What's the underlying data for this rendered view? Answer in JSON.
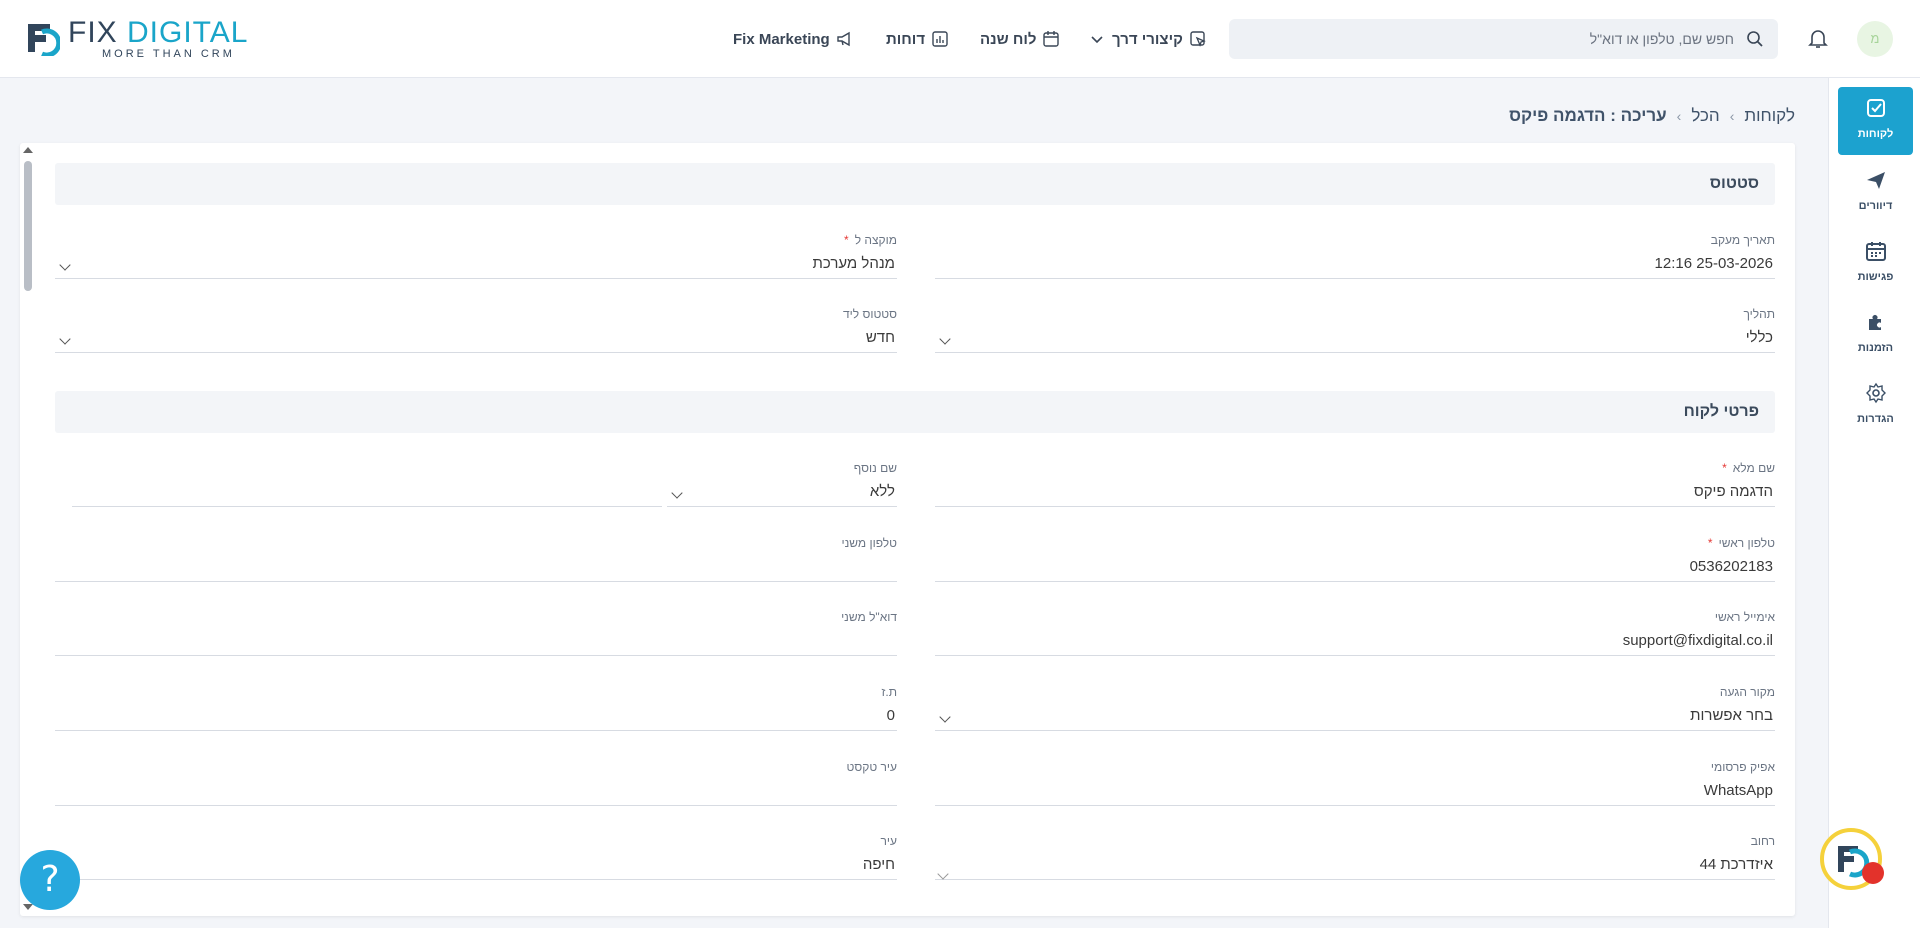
{
  "brand": {
    "name_a": "FIX ",
    "name_b": "DIGITAL",
    "tagline": "MORE THAN CRM",
    "accent": "#1ca2cf"
  },
  "header": {
    "search_placeholder": "חפש שם, טלפון או דוא\"ל",
    "nav": {
      "marketing": "Fix Marketing",
      "reports": "דוחות",
      "calendar": "לוח שנה",
      "shortcuts": "קיצורי דרך"
    },
    "avatar_initial": "מ"
  },
  "sidebar": {
    "items": [
      {
        "label": "לקוחות",
        "icon": "check-square-icon",
        "active": true
      },
      {
        "label": "דיוורים",
        "icon": "paper-plane-icon"
      },
      {
        "label": "פגישות",
        "icon": "calendar-icon"
      },
      {
        "label": "הזמנות",
        "icon": "puzzle-icon"
      },
      {
        "label": "הגדרות",
        "icon": "gear-icon"
      }
    ]
  },
  "breadcrumb": {
    "root": "לקוחות",
    "level2": "הכל",
    "current": "עריכה : הדגמה פיקס",
    "sep": "›"
  },
  "sections": {
    "status": "סטטוס",
    "customer": "פרטי לקוח"
  },
  "status_fields": {
    "followup_date": {
      "label": "תאריך מעקב",
      "value": "25-03-2026 12:16"
    },
    "assigned_to": {
      "label": "מוקצה ל",
      "value": "מנהל מערכת",
      "required": "*"
    },
    "process": {
      "label": "תהליך",
      "value": "כללי"
    },
    "lead_status": {
      "label": "סטטוס ליד",
      "value": "חדש"
    }
  },
  "customer_fields": {
    "full_name": {
      "label": "שם מלא",
      "value": "הדגמה פיקס",
      "required": "*"
    },
    "extra_name": {
      "label": "שם נוסף",
      "value": "ללא"
    },
    "main_phone": {
      "label": "טלפון ראשי",
      "value": "0536202183",
      "required": "*"
    },
    "secondary_phone": {
      "label": "טלפון משני",
      "value": ""
    },
    "main_email": {
      "label": "אימייל ראשי",
      "value": "support@fixdigital.co.il"
    },
    "secondary_email": {
      "label": "דוא\"ל משני",
      "value": ""
    },
    "source": {
      "label": "מקור הגעה",
      "value": "בחר אפשרות"
    },
    "id_number": {
      "label": "ת.ז",
      "value": "0"
    },
    "ad_channel": {
      "label": "אפיק פרסומי",
      "value": "WhatsApp"
    },
    "city_text": {
      "label": "עיר טקסט",
      "value": ""
    },
    "street": {
      "label": "רחוב",
      "value": "איזדרכת 44"
    },
    "city": {
      "label": "עיר",
      "value": "חיפה"
    }
  },
  "help_label": "?"
}
